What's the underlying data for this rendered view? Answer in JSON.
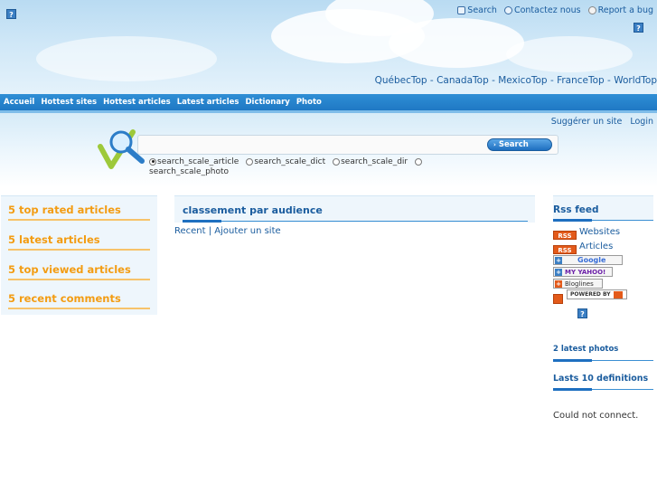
{
  "header": {
    "help_label": "?",
    "top_links": [
      {
        "label": "Search",
        "icon": "search-bubble-icon"
      },
      {
        "label": "Contactez nous",
        "icon": "contact-icon"
      },
      {
        "label": "Report a bug",
        "icon": "bug-icon"
      }
    ],
    "region_links": [
      "QuébecTop",
      "CanadaTop",
      "MexicoTop",
      "FranceTop",
      "WorldTop"
    ],
    "region_separator": " - "
  },
  "nav": {
    "items": [
      "Accueil",
      "Hottest sites",
      "Hottest articles",
      "Latest articles",
      "Dictionary",
      "Photo"
    ]
  },
  "search": {
    "user_links": [
      "Suggérer un site",
      "Login"
    ],
    "input_value": "",
    "button_label": "Search",
    "scopes": [
      {
        "label": "search_scale_article",
        "checked": true
      },
      {
        "label": "search_scale_dict",
        "checked": false
      },
      {
        "label": "search_scale_dir",
        "checked": false
      },
      {
        "label": "search_scale_photo",
        "checked": false
      }
    ]
  },
  "left": {
    "items": [
      "5 top rated articles",
      "5 latest articles",
      "5 top viewed articles",
      "5 recent comments"
    ]
  },
  "center": {
    "title": "classement par audience",
    "link_recent": "Recent",
    "link_sep": " | ",
    "link_add": "Ajouter un site"
  },
  "right": {
    "rss_title": "Rss feed",
    "rss_badge": "RSS",
    "rss_websites": "Websites",
    "rss_articles": "Articles",
    "aggregators": [
      "Google",
      "MY YAHOO!",
      "Bloglines",
      "POWERED BY"
    ],
    "latest_photos": "2 latest photos",
    "lasts_definitions": "Lasts 10 definitions",
    "not_connect": "Could not connect."
  },
  "colors": {
    "link_blue": "#1a5c9e",
    "nav_blue": "#1f78c4",
    "orange_heading": "#f39c12",
    "rss_orange": "#e35a1a"
  }
}
